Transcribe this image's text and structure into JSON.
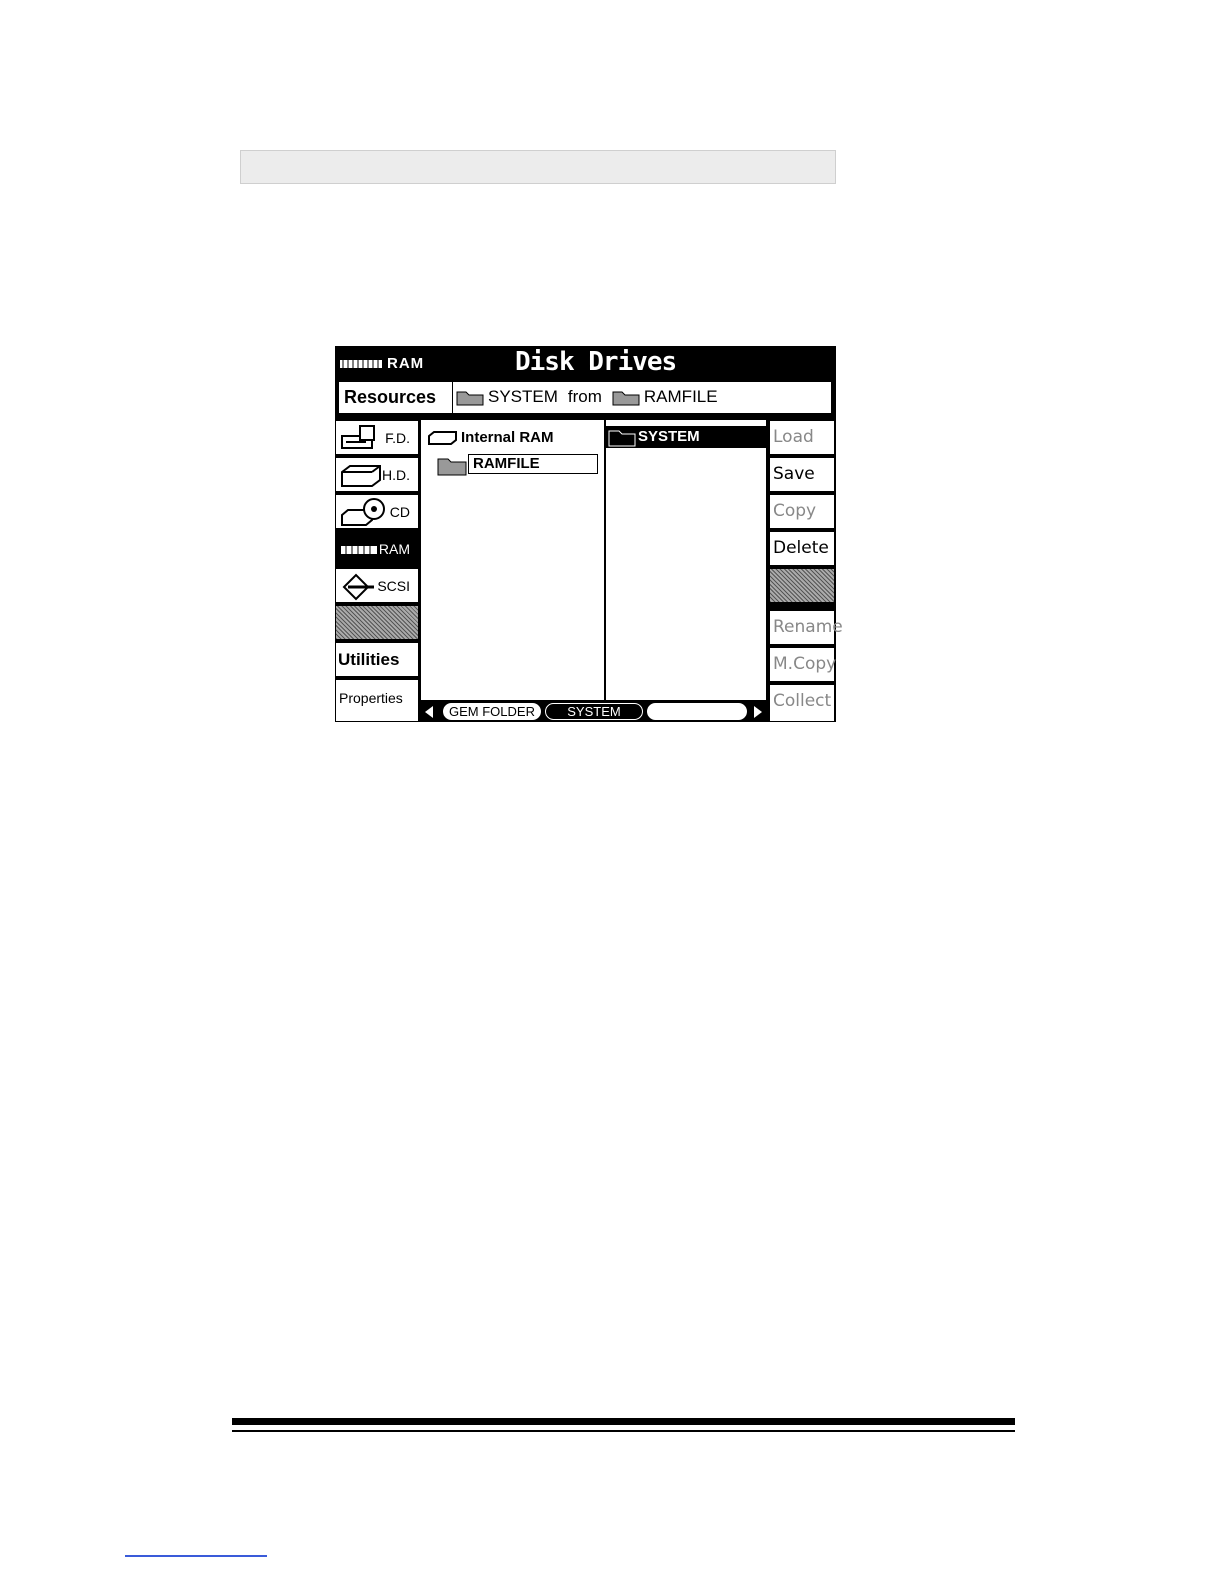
{
  "title_bar": {
    "drive_label": "RAM",
    "title": "Disk Drives"
  },
  "resources_bar": {
    "label": "Resources",
    "path_folder": "SYSTEM",
    "path_from": "from",
    "path_source": "RAMFILE"
  },
  "left_column": {
    "items": [
      {
        "label": "F.D."
      },
      {
        "label": "H.D."
      },
      {
        "label": "CD"
      },
      {
        "label": "RAM"
      },
      {
        "label": "SCSI"
      },
      {
        "label": ""
      },
      {
        "label": "Utilities"
      },
      {
        "label": "Properties"
      }
    ]
  },
  "tree_panel": {
    "root": "Internal RAM",
    "child": "RAMFILE"
  },
  "file_panel": {
    "selected": "SYSTEM"
  },
  "tabs": {
    "items": [
      "GEM FOLDER",
      "SYSTEM",
      ""
    ]
  },
  "right_column": {
    "items": [
      {
        "label": "Load"
      },
      {
        "label": "Save"
      },
      {
        "label": "Copy"
      },
      {
        "label": "Delete"
      },
      {
        "label": ""
      },
      {
        "label": "Rename"
      },
      {
        "label": "M.Copy"
      },
      {
        "label": "Collect"
      }
    ]
  },
  "colors": {
    "screen_bg": "#000000",
    "panel_bg": "#ffffff",
    "disabled_text": "#888888",
    "link_rule": "#3a5bd9"
  }
}
